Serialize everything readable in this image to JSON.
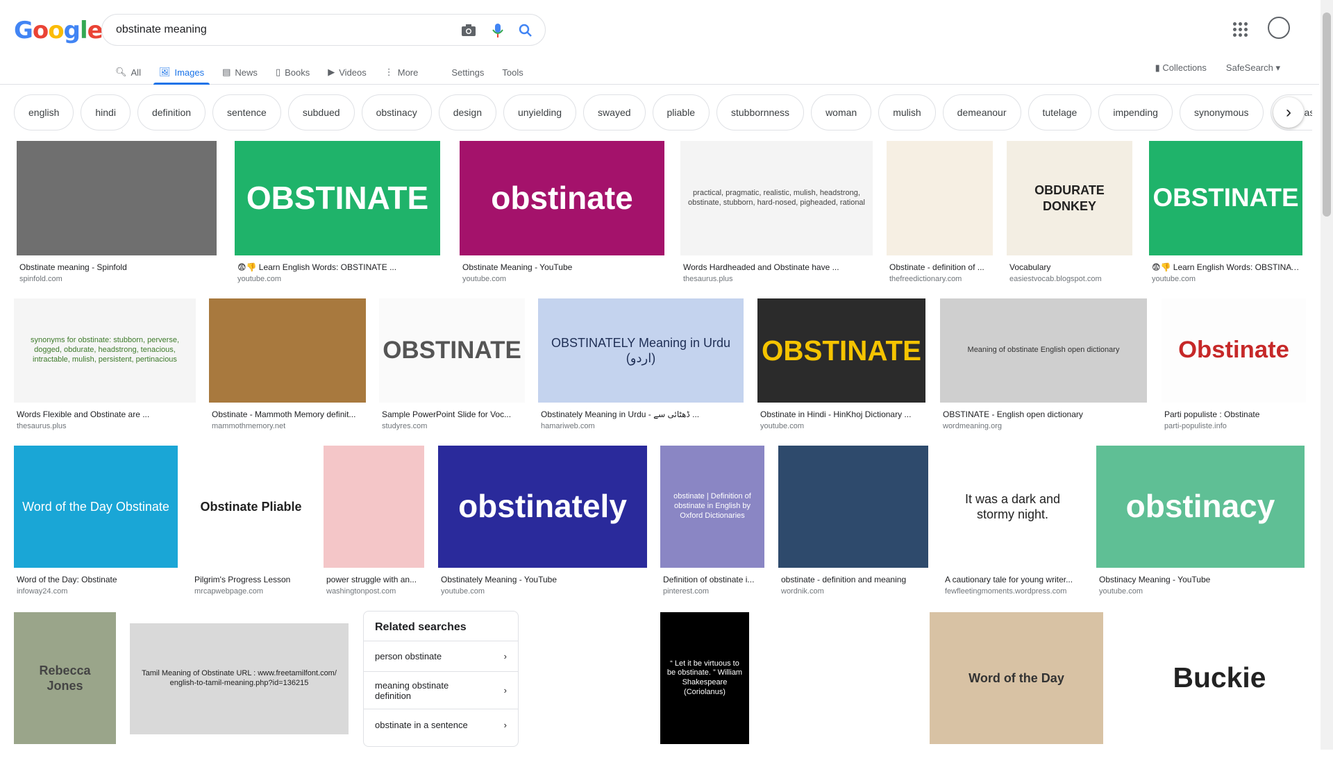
{
  "logo": {
    "letters": [
      "G",
      "o",
      "o",
      "g",
      "l",
      "e"
    ],
    "colors": [
      "#4285f4",
      "#ea4335",
      "#fbbc05",
      "#4285f4",
      "#34a853",
      "#ea4335"
    ]
  },
  "search": {
    "value": "obstinate meaning"
  },
  "nav": {
    "tabs": [
      {
        "label": "All",
        "icon": "search-icon",
        "active": false
      },
      {
        "label": "Images",
        "icon": "image-icon",
        "active": true
      },
      {
        "label": "News",
        "icon": "news-icon",
        "active": false
      },
      {
        "label": "Books",
        "icon": "book-icon",
        "active": false
      },
      {
        "label": "Videos",
        "icon": "video-icon",
        "active": false
      },
      {
        "label": "More",
        "icon": "more-icon",
        "active": false
      }
    ],
    "settings": "Settings",
    "tools": "Tools",
    "collections": "Collections",
    "safesearch": "SafeSearch"
  },
  "chips": [
    "english",
    "hindi",
    "definition",
    "sentence",
    "subdued",
    "obstinacy",
    "design",
    "unyielding",
    "swayed",
    "pliable",
    "stubbornness",
    "woman",
    "mulish",
    "demeanour",
    "tutelage",
    "impending",
    "synonymous",
    "unreasonable"
  ],
  "results": [
    {
      "title": "Obstinate meaning - Spinfold",
      "source": "spinfold.com",
      "bg": "#6f6f6f",
      "fg": "#fff",
      "text": ""
    },
    {
      "title": "😨👎 Learn English Words: OBSTINATE ...",
      "source": "youtube.com",
      "bg": "#1fb36a",
      "fg": "#fff",
      "text": "OBSTINATE"
    },
    {
      "title": "Obstinate Meaning - YouTube",
      "source": "youtube.com",
      "bg": "#a4126b",
      "fg": "#fff",
      "text": "obstinate"
    },
    {
      "title": "Words Hardheaded and Obstinate have ...",
      "source": "thesaurus.plus",
      "bg": "#f4f4f4",
      "fg": "#444",
      "text": "practical, pragmatic, realistic, mulish, headstrong, obstinate, stubborn, hard-nosed, pigheaded, rational"
    },
    {
      "title": "Obstinate - definition of ...",
      "source": "thefreedictionary.com",
      "bg": "#f6efe3",
      "fg": "#444",
      "text": ""
    },
    {
      "title": "Vocabulary",
      "source": "easiestvocab.blogspot.com",
      "bg": "#f3eee3",
      "fg": "#222",
      "text": "OBDURATE DONKEY"
    },
    {
      "title": "😨👎 Learn English Words: OBSTINATE ...",
      "source": "youtube.com",
      "bg": "#1fb36a",
      "fg": "#fff",
      "text": "OBSTINATE"
    },
    {
      "title": "Words Flexible and Obstinate are ...",
      "source": "thesaurus.plus",
      "bg": "#f5f5f5",
      "fg": "#3d7a2a",
      "text": "synonyms for obstinate: stubborn, perverse, dogged, obdurate, headstrong, tenacious, intractable, mulish, persistent, pertinacious"
    },
    {
      "title": "Obstinate - Mammoth Memory definit...",
      "source": "mammothmemory.net",
      "bg": "#a8793e",
      "fg": "#fff",
      "text": ""
    },
    {
      "title": "Sample PowerPoint Slide for Voc...",
      "source": "studyres.com",
      "bg": "#fafafa",
      "fg": "#555",
      "text": "OBSTINATE"
    },
    {
      "title": "Obstinately Meaning in Urdu - ڈھٹائی سے ...",
      "source": "hamariweb.com",
      "bg": "#c4d3ee",
      "fg": "#1f2f55",
      "text": "OBSTINATELY  Meaning in Urdu (اردو)"
    },
    {
      "title": "Obstinate in Hindi - HinKhoj Dictionary ...",
      "source": "youtube.com",
      "bg": "#2b2b2b",
      "fg": "#f5c400",
      "text": "OBSTINATE"
    },
    {
      "title": "OBSTINATE - English open dictionary",
      "source": "wordmeaning.org",
      "bg": "#cfcfcf",
      "fg": "#333",
      "text": "Meaning of obstinate English open dictionary"
    },
    {
      "title": "Parti populiste : Obstinate",
      "source": "parti-populiste.info",
      "bg": "#fdfdfd",
      "fg": "#c62828",
      "text": "Obstinate"
    },
    {
      "title": "Word of the Day: Obstinate",
      "source": "infoway24.com",
      "bg": "#1aa6d6",
      "fg": "#fff",
      "text": "Word of the Day  Obstinate"
    },
    {
      "title": "Pilgrim's Progress Lesson",
      "source": "mrcapwebpage.com",
      "bg": "#ffffff",
      "fg": "#222",
      "text": "Obstinate  Pliable"
    },
    {
      "title": "power struggle with an...",
      "source": "washingtonpost.com",
      "bg": "#f4c6c8",
      "fg": "#333",
      "text": ""
    },
    {
      "title": "Obstinately Meaning - YouTube",
      "source": "youtube.com",
      "bg": "#2a2a9b",
      "fg": "#fff",
      "text": "obstinately"
    },
    {
      "title": "Definition of obstinate i...",
      "source": "pinterest.com",
      "bg": "#8a86c4",
      "fg": "#fff",
      "text": "obstinate | Definition of obstinate in English by Oxford Dictionaries"
    },
    {
      "title": "obstinate - definition and meaning",
      "source": "wordnik.com",
      "bg": "#2e4a6c",
      "fg": "#e8d9a8",
      "text": ""
    },
    {
      "title": "A cautionary tale for young writer...",
      "source": "fewfleetingmoments.wordpress.com",
      "bg": "#ffffff",
      "fg": "#222",
      "text": "It was a dark and stormy night."
    },
    {
      "title": "Obstinacy Meaning - YouTube",
      "source": "youtube.com",
      "bg": "#5fbf95",
      "fg": "#fff",
      "text": "obstinacy"
    },
    {
      "title": "",
      "source": "",
      "bg": "#9aa58a",
      "fg": "#444",
      "text": "Rebecca Jones"
    },
    {
      "title": "",
      "source": "",
      "bg": "#d9d9d9",
      "fg": "#222",
      "text": "Tamil Meaning of Obstinate  URL : www.freetamilfont.com/ english-to-tamil-meaning.php?id=136215"
    },
    {
      "title": "",
      "source": "",
      "bg": "#ffffff",
      "fg": "#555",
      "text": ""
    },
    {
      "title": "",
      "source": "",
      "bg": "#000000",
      "fg": "#fff",
      "text": "“ Let it be virtuous to be obstinate. ”  William Shakespeare (Coriolanus)"
    },
    {
      "title": "",
      "source": "",
      "bg": "#ffffff",
      "fg": "#111",
      "text": ""
    },
    {
      "title": "",
      "source": "",
      "bg": "#d8c2a4",
      "fg": "#333",
      "text": "Word of the Day"
    },
    {
      "title": "",
      "source": "",
      "bg": "#ffffff",
      "fg": "#222",
      "text": "Buckie"
    }
  ],
  "related": {
    "title": "Related searches",
    "items": [
      "person obstinate",
      "meaning obstinate definition",
      "obstinate in a sentence"
    ]
  }
}
